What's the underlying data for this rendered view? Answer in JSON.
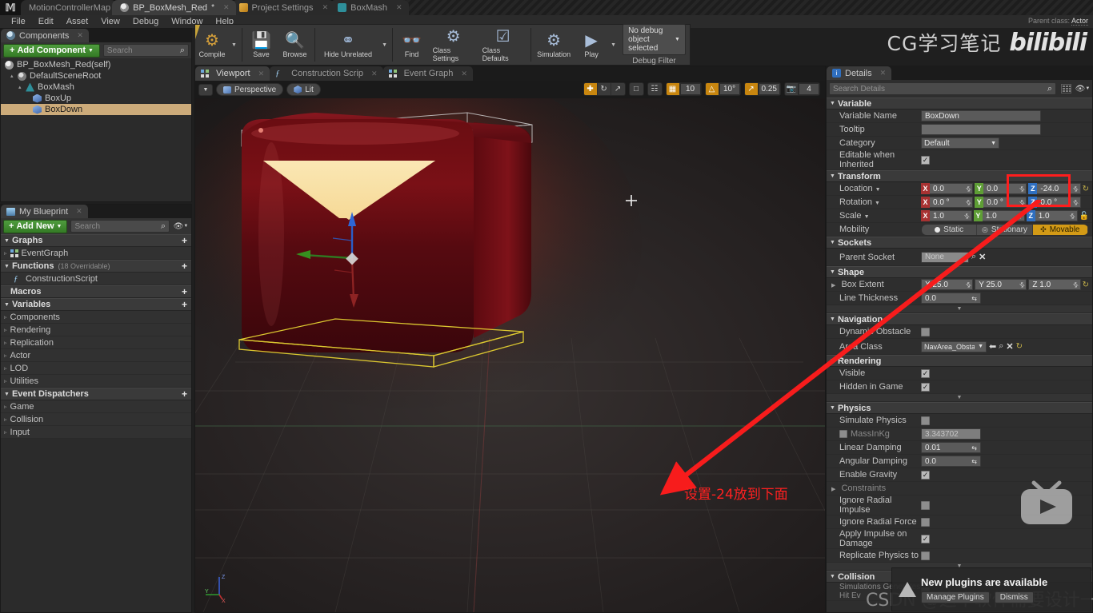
{
  "titlebar": {
    "tabs": [
      {
        "label": "MotionControllerMap",
        "icon": "map-icon",
        "active": false,
        "closable": false
      },
      {
        "label": "BP_BoxMesh_Red",
        "icon": "blueprint-icon",
        "active": true,
        "closable": true,
        "dirty": true
      },
      {
        "label": "Project Settings",
        "icon": "project-settings-icon",
        "active": false,
        "closable": true
      },
      {
        "label": "BoxMash",
        "icon": "mesh-icon",
        "active": false,
        "closable": true
      }
    ]
  },
  "menubar": {
    "items": [
      "File",
      "Edit",
      "Asset",
      "View",
      "Debug",
      "Window",
      "Help"
    ]
  },
  "parent_class": {
    "label": "Parent class:",
    "value": "Actor"
  },
  "toolbar": {
    "items": [
      {
        "label": "Compile",
        "icon": "compile-gear-question-icon",
        "has_dropdown": true
      },
      {
        "label": "Save",
        "icon": "floppy-disk-icon"
      },
      {
        "label": "Browse",
        "icon": "magnifier-icon"
      },
      {
        "label": "Hide Unrelated",
        "icon": "node-graph-icon",
        "has_dropdown": true
      },
      {
        "label": "Find",
        "icon": "binoculars-icon"
      },
      {
        "label": "Class Settings",
        "icon": "gear-document-icon"
      },
      {
        "label": "Class Defaults",
        "icon": "checklist-icon"
      },
      {
        "label": "Simulation",
        "icon": "gear-play-icon"
      },
      {
        "label": "Play",
        "icon": "play-triangle-icon",
        "has_dropdown": true
      }
    ],
    "debug_object": "No debug object selected",
    "debug_filter_label": "Debug Filter"
  },
  "components_panel": {
    "tab_label": "Components",
    "add_button": "Add Component",
    "search_placeholder": "Search",
    "tree": [
      {
        "label": "BP_BoxMesh_Red(self)",
        "depth": 0,
        "icon": "self-actor-icon",
        "selected": false,
        "expander": ""
      },
      {
        "label": "DefaultSceneRoot",
        "depth": 1,
        "icon": "scene-root-icon",
        "selected": false,
        "expander": "▴"
      },
      {
        "label": "BoxMash",
        "depth": 2,
        "icon": "static-mesh-icon",
        "selected": false,
        "expander": "▴"
      },
      {
        "label": "BoxUp",
        "depth": 3,
        "icon": "box-collision-icon",
        "selected": false,
        "expander": ""
      },
      {
        "label": "BoxDown",
        "depth": 3,
        "icon": "box-collision-icon",
        "selected": true,
        "expander": ""
      }
    ]
  },
  "myblueprint_panel": {
    "tab_label": "My Blueprint",
    "add_button": "Add New",
    "search_placeholder": "Search",
    "sections": [
      {
        "title": "Graphs",
        "has_plus": true,
        "collapsible": true,
        "items": [
          {
            "label": "EventGraph",
            "icon": "event-graph-icon",
            "expander": "▹"
          }
        ]
      },
      {
        "title": "Functions",
        "note": "(18 Overridable)",
        "has_plus": true,
        "collapsible": true,
        "items": [
          {
            "label": "ConstructionScript",
            "icon": "function-icon",
            "expander": ""
          }
        ]
      },
      {
        "title": "Macros",
        "has_plus": true,
        "collapsible": false,
        "items": []
      },
      {
        "title": "Variables",
        "has_plus": true,
        "collapsible": true,
        "items": [
          {
            "label": "Components",
            "expander": "▹"
          },
          {
            "label": "Rendering",
            "expander": "▹"
          },
          {
            "label": "Replication",
            "expander": "▹"
          },
          {
            "label": "Actor",
            "expander": "▹"
          },
          {
            "label": "LOD",
            "expander": "▹"
          },
          {
            "label": "Utilities",
            "expander": "▹"
          }
        ]
      },
      {
        "title": "Event Dispatchers",
        "has_plus": true,
        "collapsible": true,
        "items": [
          {
            "label": "Game",
            "expander": "▹"
          },
          {
            "label": "Collision",
            "expander": "▹"
          },
          {
            "label": "Input",
            "expander": "▹"
          }
        ]
      }
    ]
  },
  "viewport": {
    "tabs": [
      {
        "label": "Viewport",
        "icon": "viewport-icon",
        "active": true
      },
      {
        "label": "Construction Scrip",
        "icon": "function-icon",
        "active": false
      },
      {
        "label": "Event Graph",
        "icon": "event-graph-icon",
        "active": false
      }
    ],
    "view_mode_button": "Perspective",
    "lit_button": "Lit",
    "snap": {
      "translate_snap_value": "10",
      "rotate_snap_value": "10°",
      "scale_snap_value": "0.25",
      "camera_speed_value": "4"
    },
    "axis_labels": {
      "x": "X",
      "y": "Y",
      "z": "Z"
    }
  },
  "details_panel": {
    "tab_label": "Details",
    "search_placeholder": "Search Details",
    "sections": [
      {
        "title": "Variable",
        "rows": [
          {
            "label": "Variable Name",
            "type": "text",
            "value": "BoxDown"
          },
          {
            "label": "Tooltip",
            "type": "text",
            "value": ""
          },
          {
            "label": "Category",
            "type": "dropdown",
            "value": "Default"
          },
          {
            "label": "Editable when Inherited",
            "type": "checkbox",
            "checked": true
          }
        ]
      },
      {
        "title": "Transform",
        "rows": [
          {
            "label": "Location",
            "type": "vector",
            "x": "0.0",
            "y": "0.0",
            "z": "-24.0",
            "highlight_z": true
          },
          {
            "label": "Rotation",
            "type": "vector",
            "x": "0.0 °",
            "y": "0.0 °",
            "z": "0.0 °"
          },
          {
            "label": "Scale",
            "type": "vector",
            "x": "1.0",
            "y": "1.0",
            "z": "1.0"
          },
          {
            "label": "Mobility",
            "type": "mobility",
            "options": [
              "Static",
              "Stationary",
              "Movable"
            ],
            "selected": "Movable"
          }
        ]
      },
      {
        "title": "Sockets",
        "rows": [
          {
            "label": "Parent Socket",
            "type": "socket",
            "value": "None"
          }
        ]
      },
      {
        "title": "Shape",
        "rows": [
          {
            "label": "Box Extent",
            "type": "plainvector",
            "x": "X  25.0",
            "y": "Y  25.0",
            "z": "Z  1.0"
          },
          {
            "label": "Line Thickness",
            "type": "numeric",
            "value": "0.0"
          }
        ]
      },
      {
        "title": "Navigation",
        "rows": [
          {
            "label": "Dynamic Obstacle",
            "type": "checkbox",
            "checked": false
          },
          {
            "label": "Area Class",
            "type": "assetdrop",
            "value": "NavArea_Obstacle"
          }
        ]
      },
      {
        "title": "Rendering",
        "rows": [
          {
            "label": "Visible",
            "type": "checkbox",
            "checked": true
          },
          {
            "label": "Hidden in Game",
            "type": "checkbox",
            "checked": true
          }
        ]
      },
      {
        "title": "Physics",
        "rows": [
          {
            "label": "Simulate Physics",
            "type": "checkbox",
            "checked": false
          },
          {
            "label": "MassInKg",
            "type": "checkbox-value",
            "checked": false,
            "value": "3.343702",
            "dim": true
          },
          {
            "label": "Linear Damping",
            "type": "numeric",
            "value": "0.01"
          },
          {
            "label": "Angular Damping",
            "type": "numeric",
            "value": "0.0"
          },
          {
            "label": "Enable Gravity",
            "type": "checkbox",
            "checked": true
          },
          {
            "label": "Constraints",
            "type": "expander"
          },
          {
            "label": "Ignore Radial Impulse",
            "type": "checkbox",
            "checked": false
          },
          {
            "label": "Ignore Radial Force",
            "type": "checkbox",
            "checked": false
          },
          {
            "label": "Apply Impulse on Damage",
            "type": "checkbox",
            "checked": true
          },
          {
            "label": "Replicate Physics to",
            "type": "checkbox",
            "checked": false
          }
        ]
      },
      {
        "title": "Collision",
        "rows": [
          {
            "label": "Simulations Generates Hit Ev",
            "type": "checkbox",
            "checked": false
          }
        ]
      }
    ]
  },
  "annotations": {
    "chinese_note": "设置-24放到下面",
    "highlight_color": "#fe1d1d",
    "arrow_color": "#f71c1c"
  },
  "watermarks": {
    "cg_text": "CG学习笔记",
    "bilibili_text": "bilibili",
    "csdn_text": "CSDN @这个软件需要设计一下"
  },
  "notification": {
    "title": "New plugins are available",
    "manage_button": "Manage Plugins",
    "dismiss_button": "Dismiss"
  }
}
